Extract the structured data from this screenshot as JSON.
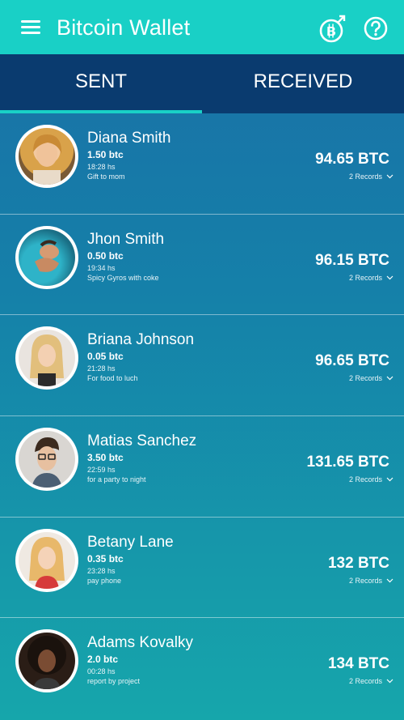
{
  "header": {
    "title": "Bitcoin Wallet",
    "menu_icon": "hamburger-menu-icon",
    "send_icon": "bitcoin-send-icon",
    "help_icon": "help-icon"
  },
  "tabs": [
    {
      "label": "SENT",
      "active": true
    },
    {
      "label": "RECEIVED",
      "active": false
    }
  ],
  "colors": {
    "appbar": "#19d0c6",
    "tabbar": "#0a3b6f",
    "indicator": "#19d0c6",
    "list_top": "#1a6fa6",
    "list_bottom": "#16a6ab"
  },
  "transactions": [
    {
      "name": "Diana Smith",
      "amount": "1.50 btc",
      "time": "18:28 hs",
      "note": "Gift to mom",
      "total": "94.65 BTC",
      "records": "2 Records"
    },
    {
      "name": "Jhon Smith",
      "amount": "0.50 btc",
      "time": "19:34 hs",
      "note": "Spicy Gyros with coke",
      "total": "96.15 BTC",
      "records": "2 Records"
    },
    {
      "name": "Briana Johnson",
      "amount": "0.05 btc",
      "time": "21:28 hs",
      "note": "For food to luch",
      "total": "96.65 BTC",
      "records": "2 Records"
    },
    {
      "name": "Matias Sanchez",
      "amount": "3.50 btc",
      "time": "22:59 hs",
      "note": "for a party to night",
      "total": "131.65 BTC",
      "records": "2 Records"
    },
    {
      "name": "Betany Lane",
      "amount": "0.35 btc",
      "time": "23:28 hs",
      "note": "pay phone",
      "total": "132 BTC",
      "records": "2 Records"
    },
    {
      "name": "Adams Kovalky",
      "amount": "2.0 btc",
      "time": "00:28 hs",
      "note": "report by project",
      "total": "134 BTC",
      "records": "2 Records"
    }
  ]
}
